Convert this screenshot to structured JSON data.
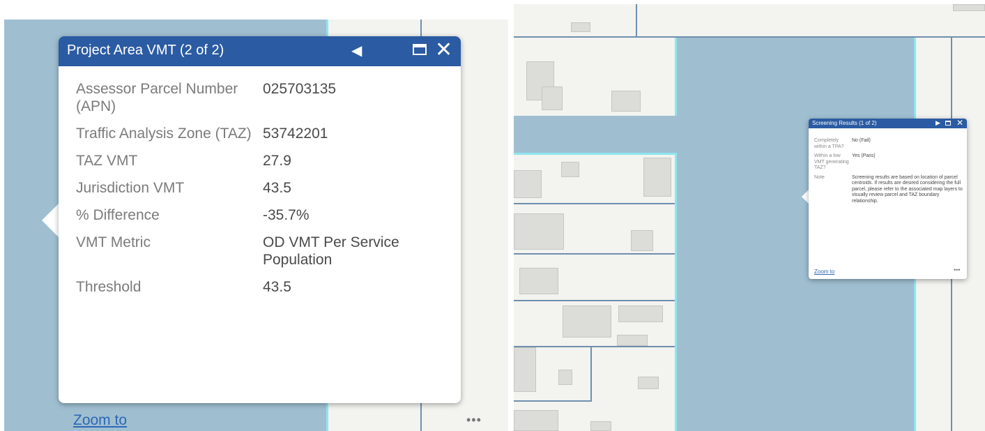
{
  "left_popup": {
    "title": "Project Area VMT (2 of 2)",
    "fields": [
      {
        "label": "Assessor Parcel Number (APN)",
        "value": "025703135"
      },
      {
        "label": "Traffic Analysis Zone (TAZ)",
        "value": "53742201"
      },
      {
        "label": "TAZ VMT",
        "value": "27.9"
      },
      {
        "label": "Jurisdiction VMT",
        "value": "43.5"
      },
      {
        "label": "% Difference",
        "value": "-35.7%"
      },
      {
        "label": "VMT Metric",
        "value": "OD VMT Per Service Population"
      },
      {
        "label": "Threshold",
        "value": "43.5"
      }
    ],
    "zoom_label": "Zoom to",
    "more_label": "•••"
  },
  "right_popup": {
    "title": "Screening Results (1 of 2)",
    "fields": [
      {
        "label": "Completely within a TPA?",
        "value": "No (Fail)"
      },
      {
        "label": "Within a low VMT generating TAZ?",
        "value": "Yes (Pass)"
      },
      {
        "label": "Note",
        "value": "Screening results are based on location of parcel centroids. If results are desired considering the full parcel, please refer to the associated map layers to visually review parcel and TAZ boundary relationship."
      }
    ],
    "zoom_label": "Zoom to",
    "more_label": "•••"
  },
  "colors": {
    "header": "#2b5ba2",
    "parcel_highlight": "#9fbfd1",
    "map_background": "#f3f3ef",
    "link": "#2f67b3"
  },
  "icons": [
    "previous-icon",
    "next-icon",
    "maximize-icon",
    "close-icon",
    "more-icon"
  ]
}
